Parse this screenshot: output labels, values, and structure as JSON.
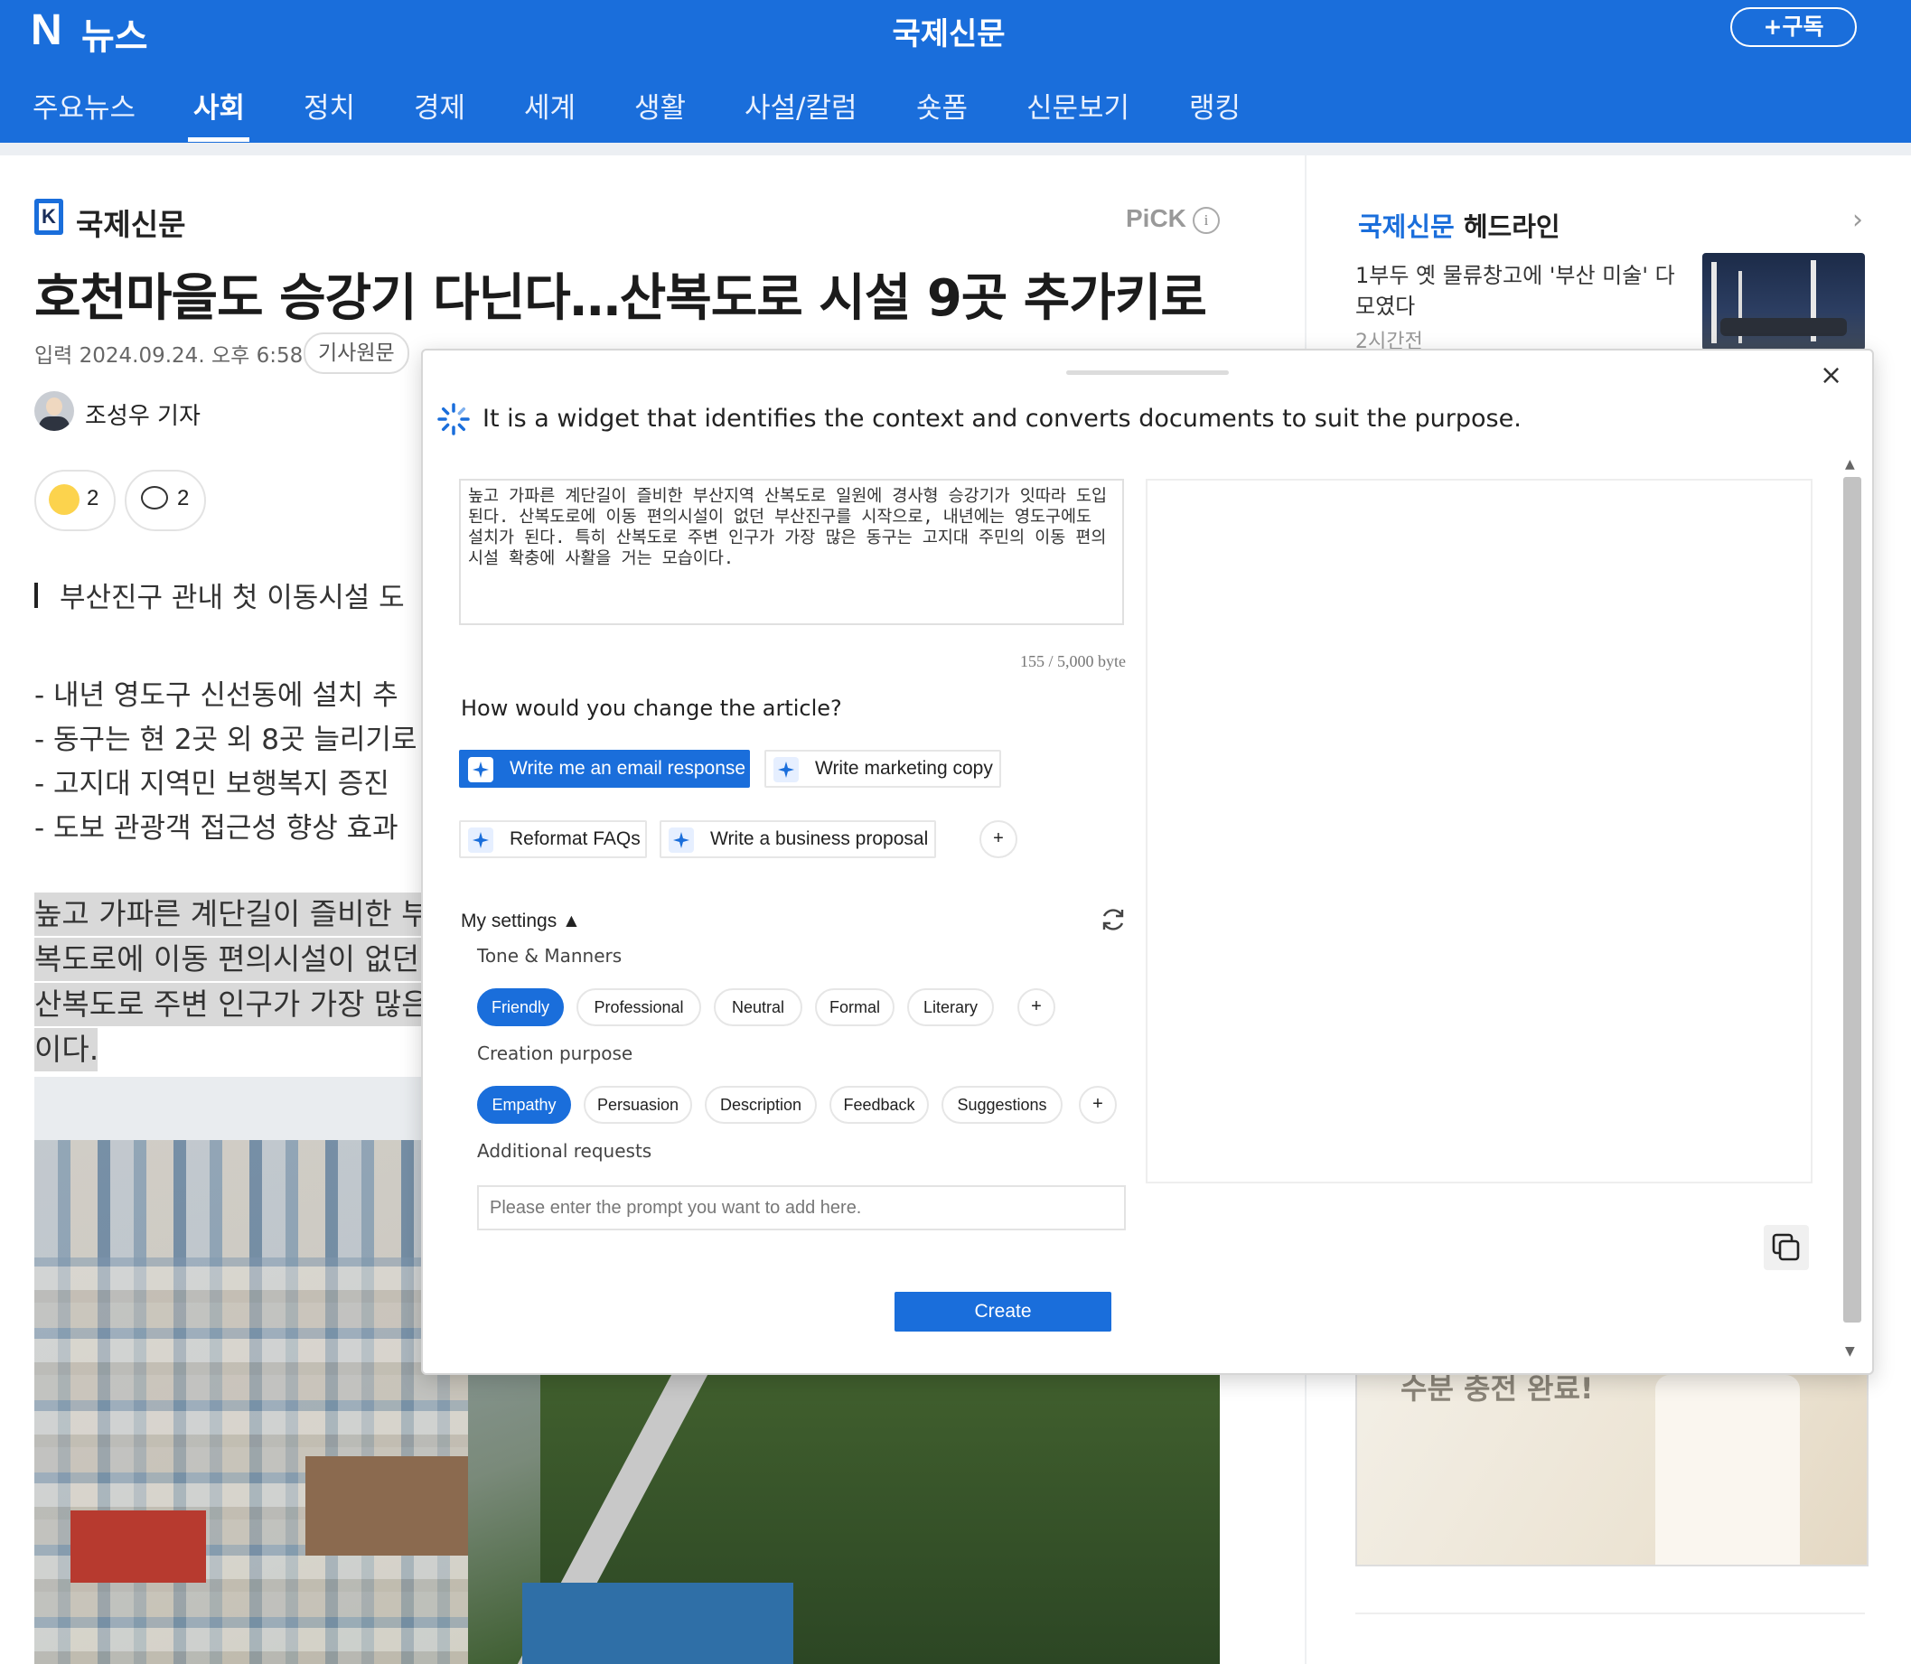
{
  "header": {
    "logo_n": "N",
    "logo_news": "뉴스",
    "press_title": "국제신문",
    "subscribe_label": "+구독"
  },
  "nav": {
    "items": [
      "주요뉴스",
      "사회",
      "정치",
      "경제",
      "세계",
      "생활",
      "사설/칼럼",
      "숏폼",
      "신문보기",
      "랭킹"
    ],
    "active": "사회"
  },
  "article": {
    "press_logo_letter": "K",
    "press_name": "국제신문",
    "pick_label": "PiCK",
    "pick_info": "i",
    "headline": "호천마을도 승강기 다닌다…산복도로 시설 9곳 추가키로",
    "date": "입력 2024.09.24. 오후 6:58",
    "original_label": "기사원문",
    "reporter": "조성우 기자",
    "reaction_count": "2",
    "comment_count": "2",
    "subhead": "부산진구 관내 첫 이동시설 도",
    "bullets": [
      "- 내년 영도구 신선동에 설치 추",
      "- 동구는 현 2곳 외 8곳 늘리기로",
      "- 고지대 지역민 보행복지 증진",
      "- 도보 관광객 접근성 향상 효과"
    ],
    "body_lines": [
      "높고 가파른 계단길이 즐비한 부",
      "복도로에 이동 편의시설이 없던",
      "산복도로 주변 인구가 가장 많은",
      "이다."
    ]
  },
  "rail": {
    "headline_press": "국제신문",
    "headline_suffix": "헤드라인",
    "chevron": "›",
    "item_text": "1부두 옛 물류창고에 '부산 미술' 다 모였다",
    "item_time": "2시간전",
    "ad_text": "수분 충전 완료!"
  },
  "widget": {
    "close": "×",
    "description": "It is a widget that identifies the context and converts documents to suit the purpose.",
    "source_text": "높고 가파른 계단길이 즐비한 부산지역 산복도로 일원에 경사형 승강기가 잇따라 도입된다. 산복도로에 이동 편의시설이 없던 부산진구를 시작으로, 내년에는 영도구에도 설치가 된다. 특히 산복도로 주변 인구가 가장 많은 동구는 고지대 주민의 이동 편의시설 확충에 사활을 거는 모습이다.",
    "byte_count": "155 / 5,000 byte",
    "question": "How would you change the article?",
    "actions": [
      {
        "label": "Write me an email response",
        "active": true
      },
      {
        "label": "Write marketing copy",
        "active": false
      },
      {
        "label": "Reformat FAQs",
        "active": false
      },
      {
        "label": "Write a business proposal",
        "active": false
      }
    ],
    "add_action": "+",
    "settings_label": "My settings ▲",
    "tone": {
      "label": "Tone & Manners",
      "options": [
        "Friendly",
        "Professional",
        "Neutral",
        "Formal",
        "Literary"
      ],
      "selected": "Friendly",
      "add": "+"
    },
    "purpose": {
      "label": "Creation purpose",
      "options": [
        "Empathy",
        "Persuasion",
        "Description",
        "Feedback",
        "Suggestions"
      ],
      "selected": "Empathy",
      "add": "+"
    },
    "additional": {
      "label": "Additional requests",
      "placeholder": "Please enter the prompt you want to add here.",
      "value": ""
    },
    "create_label": "Create",
    "scroll_up": "▲",
    "scroll_down": "▼"
  },
  "colors": {
    "brand_blue": "#1a6edb",
    "highlight_gray": "#d9d9d9"
  }
}
